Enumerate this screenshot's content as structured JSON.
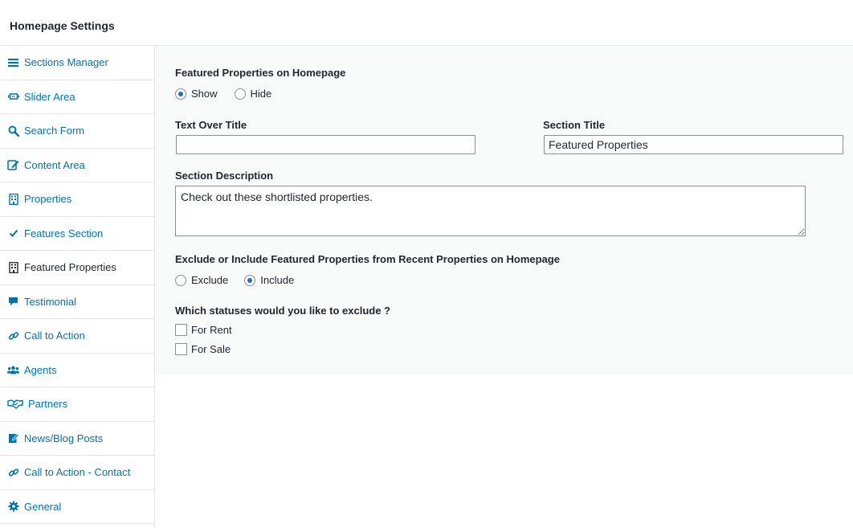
{
  "header": {
    "title": "Homepage Settings"
  },
  "sidebar": {
    "items": [
      {
        "label": "Sections Manager",
        "icon": "menu-lines-icon"
      },
      {
        "label": "Slider Area",
        "icon": "slider-icon"
      },
      {
        "label": "Search Form",
        "icon": "search-icon"
      },
      {
        "label": "Content Area",
        "icon": "edit-icon"
      },
      {
        "label": "Properties",
        "icon": "building-icon"
      },
      {
        "label": "Features Section",
        "icon": "checkmark-icon"
      },
      {
        "label": "Featured Properties",
        "icon": "building-icon",
        "active": true
      },
      {
        "label": "Testimonial",
        "icon": "speech-bubble-icon"
      },
      {
        "label": "Call to Action",
        "icon": "link-icon"
      },
      {
        "label": "Agents",
        "icon": "users-icon"
      },
      {
        "label": "Partners",
        "icon": "handshake-icon"
      },
      {
        "label": "News/Blog Posts",
        "icon": "edit-note-icon"
      },
      {
        "label": "Call to Action - Contact",
        "icon": "link-icon"
      },
      {
        "label": "General",
        "icon": "gear-icon"
      }
    ]
  },
  "form": {
    "featured_label": "Featured Properties on Homepage",
    "featured_options": {
      "show": "Show",
      "hide": "Hide",
      "selected": "Show"
    },
    "text_over_title_label": "Text Over Title",
    "text_over_title_value": "",
    "section_title_label": "Section Title",
    "section_title_value": "Featured Properties",
    "section_description_label": "Section Description",
    "section_description_value": "Check out these shortlisted properties.",
    "exclude_include_label": "Exclude or Include Featured Properties from Recent Properties on Homepage",
    "exclude_include_options": {
      "exclude": "Exclude",
      "include": "Include",
      "selected": "Include"
    },
    "statuses_label": "Which statuses would you like to exclude ?",
    "statuses": [
      {
        "label": "For Rent",
        "checked": false
      },
      {
        "label": "For Sale",
        "checked": false
      }
    ]
  },
  "colors": {
    "link": "#0073aa",
    "accent": "#2271b1",
    "panel_bg": "#f8f9f9"
  }
}
